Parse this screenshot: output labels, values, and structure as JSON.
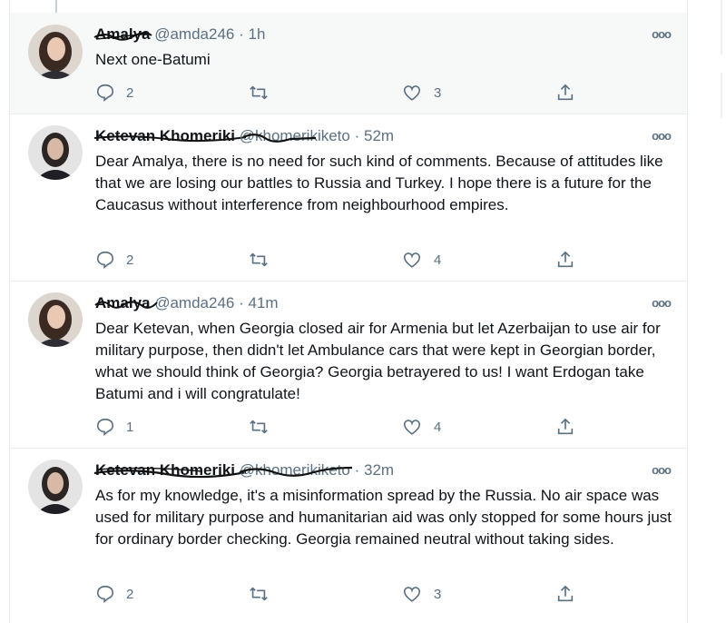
{
  "tweets": [
    {
      "name": "Amalya",
      "handle": "@amda246",
      "time": "· 1h",
      "text": "Next one-Batumi",
      "replies": "2",
      "retweets": "",
      "likes": "3"
    },
    {
      "name": "Ketevan Khomeriki",
      "handle": "@khomerikiketo",
      "time": "· 52m",
      "text": "Dear Amalya, there is no need for such kind of comments. Because of attitudes like that we are losing our battles to Russia and Turkey. I hope there is a future for the Caucasus without interference from neighbourhood empires.",
      "replies": "2",
      "retweets": "",
      "likes": "4"
    },
    {
      "name": "Amalya",
      "handle": "@amda246",
      "time": "· 41m",
      "text": "Dear Ketevan, when Georgia closed air for Armenia but let Azerbaijan to use air for military purpose, then didn't let Ambulance cars that were kept in Georgian border, what we should think of Georgia? Georgia betrayered to us! I want Erdogan take Batumi and i will congratulate!",
      "replies": "1",
      "retweets": "",
      "likes": "4"
    },
    {
      "name": "Ketevan Khomeriki",
      "handle": "@khomerikiketo",
      "time": "· 32m",
      "text": "As for my knowledge, it's a misinformation spread by the Russia. No air space was used for military purpose and humanitarian aid was only stopped for some hours just for ordinary border checking. Georgia remained neutral without taking sides.",
      "replies": "2",
      "retweets": "",
      "likes": "3"
    }
  ],
  "more_glyph": "ooo",
  "icons": {
    "reply": "reply-icon",
    "retweet": "retweet-icon",
    "like": "heart-icon",
    "share": "share-icon",
    "more": "more-icon"
  },
  "colors": {
    "text": "#0f1419",
    "secondary": "#5b7083",
    "border": "#e6ecf0",
    "highlight_bg": "#f7f9f9"
  }
}
